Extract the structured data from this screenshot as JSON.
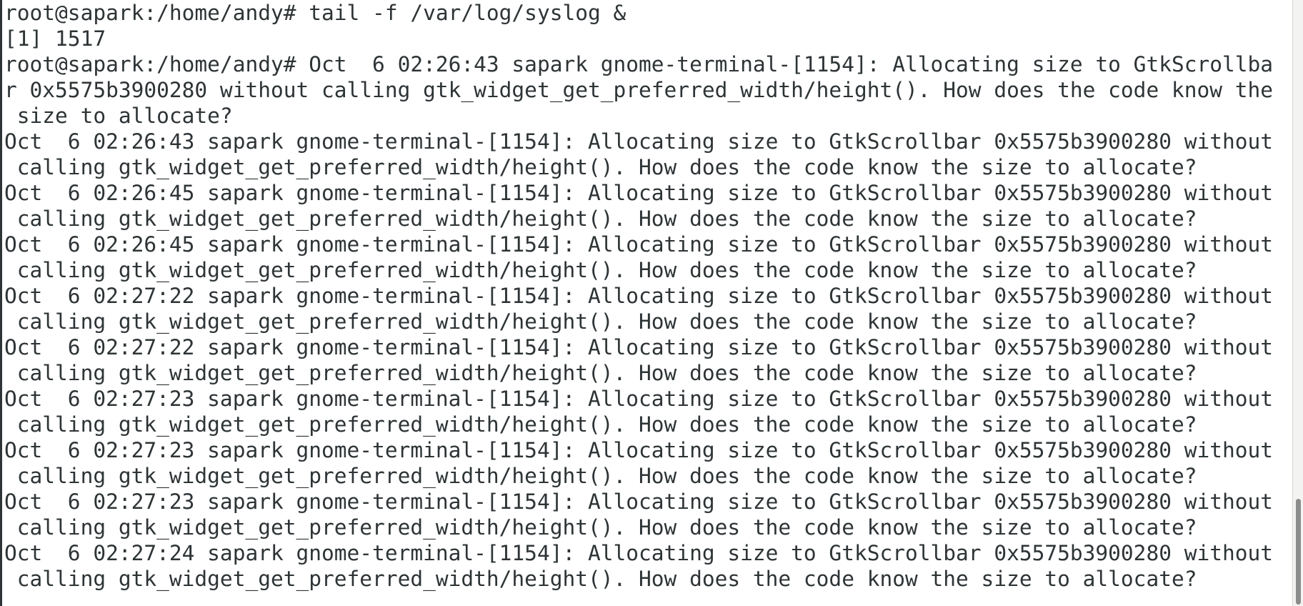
{
  "terminal": {
    "lines": [
      "root@sapark:/home/andy# tail -f /var/log/syslog &",
      "[1] 1517",
      "root@sapark:/home/andy# Oct  6 02:26:43 sapark gnome-terminal-[1154]: Allocating size to GtkScrollba",
      "r 0x5575b3900280 without calling gtk_widget_get_preferred_width/height(). How does the code know the",
      " size to allocate?",
      "Oct  6 02:26:43 sapark gnome-terminal-[1154]: Allocating size to GtkScrollbar 0x5575b3900280 without",
      " calling gtk_widget_get_preferred_width/height(). How does the code know the size to allocate?",
      "Oct  6 02:26:45 sapark gnome-terminal-[1154]: Allocating size to GtkScrollbar 0x5575b3900280 without",
      " calling gtk_widget_get_preferred_width/height(). How does the code know the size to allocate?",
      "Oct  6 02:26:45 sapark gnome-terminal-[1154]: Allocating size to GtkScrollbar 0x5575b3900280 without",
      " calling gtk_widget_get_preferred_width/height(). How does the code know the size to allocate?",
      "Oct  6 02:27:22 sapark gnome-terminal-[1154]: Allocating size to GtkScrollbar 0x5575b3900280 without",
      " calling gtk_widget_get_preferred_width/height(). How does the code know the size to allocate?",
      "Oct  6 02:27:22 sapark gnome-terminal-[1154]: Allocating size to GtkScrollbar 0x5575b3900280 without",
      " calling gtk_widget_get_preferred_width/height(). How does the code know the size to allocate?",
      "Oct  6 02:27:23 sapark gnome-terminal-[1154]: Allocating size to GtkScrollbar 0x5575b3900280 without",
      " calling gtk_widget_get_preferred_width/height(). How does the code know the size to allocate?",
      "Oct  6 02:27:23 sapark gnome-terminal-[1154]: Allocating size to GtkScrollbar 0x5575b3900280 without",
      " calling gtk_widget_get_preferred_width/height(). How does the code know the size to allocate?",
      "Oct  6 02:27:23 sapark gnome-terminal-[1154]: Allocating size to GtkScrollbar 0x5575b3900280 without",
      " calling gtk_widget_get_preferred_width/height(). How does the code know the size to allocate?",
      "Oct  6 02:27:24 sapark gnome-terminal-[1154]: Allocating size to GtkScrollbar 0x5575b3900280 without",
      " calling gtk_widget_get_preferred_width/height(). How does the code know the size to allocate?",
      ""
    ]
  },
  "colors": {
    "background": "#ffffff",
    "foreground": "#2e3436",
    "scrollbar_thumb": "#8a8d8c"
  }
}
